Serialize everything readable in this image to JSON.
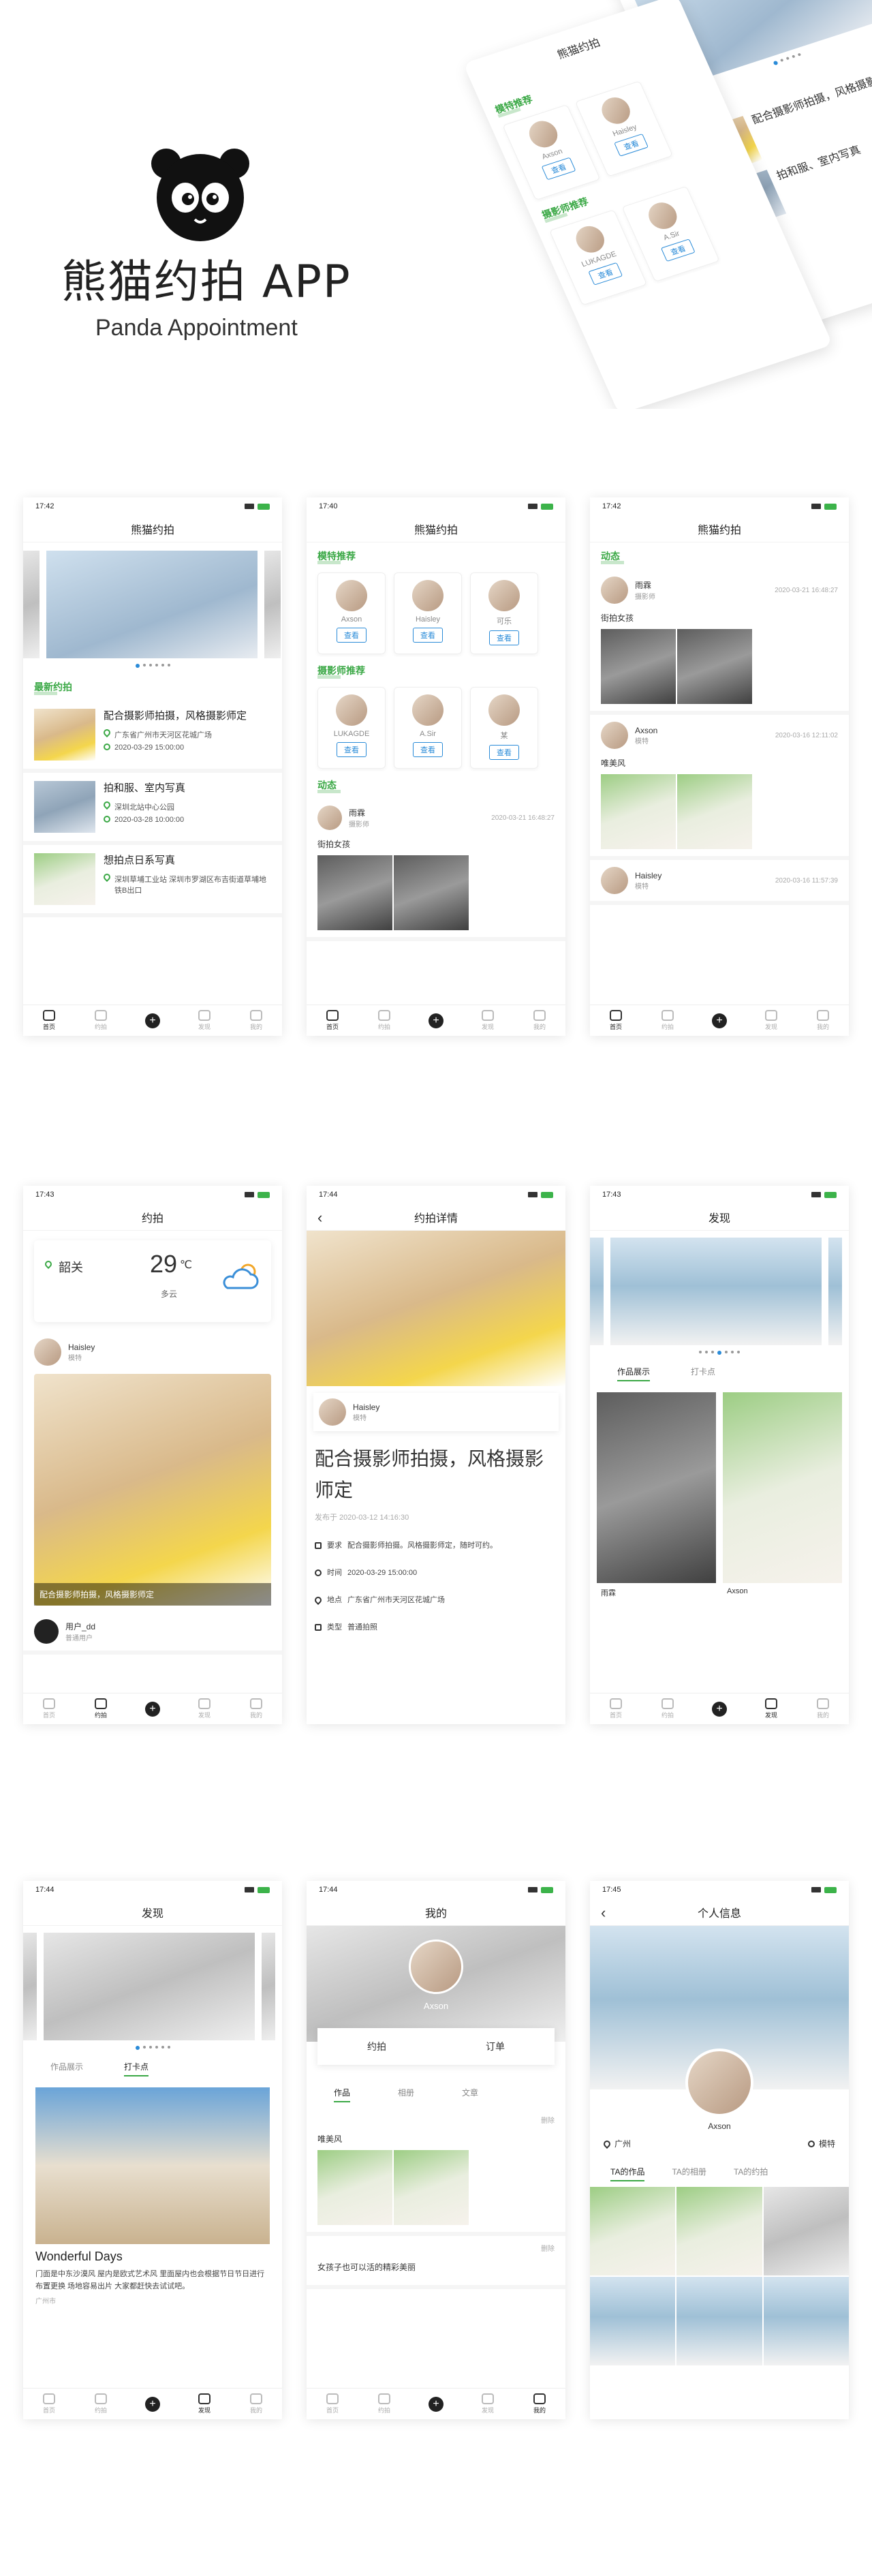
{
  "brand": {
    "title": "熊猫约拍  APP",
    "subtitle": "Panda Appointment"
  },
  "common": {
    "time1": "17:42",
    "time2": "17:40",
    "time3": "17:43",
    "time4": "17:44",
    "time5": "17:45",
    "app_title": "熊猫约拍",
    "view": "查看",
    "plus": "+",
    "tabs": [
      "首页",
      "约拍",
      "",
      "发现",
      "我的"
    ]
  },
  "sections": {
    "latest": "最新约拍",
    "model_rec": "模特推荐",
    "photographer_rec": "摄影师推荐",
    "feed": "动态"
  },
  "home": {
    "items": [
      {
        "title": "配合摄影师拍摄，风格摄影师定",
        "addr": "广东省广州市天河区花城广场",
        "time": "2020-03-29 15:00:00"
      },
      {
        "title": "拍和服、室内写真",
        "addr": "深圳北站中心公园",
        "time": "2020-03-28 10:00:00"
      },
      {
        "title": "想拍点日系写真",
        "addr": "深圳草埔工业站 深圳市罗湖区布吉街道草埔地铁B出口",
        "time": ""
      }
    ]
  },
  "models": [
    "Axson",
    "Haisley",
    "可乐"
  ],
  "photographers": [
    "LUKAGDE",
    "A.Sir",
    "某"
  ],
  "feed": [
    {
      "name": "雨霖",
      "role": "摄影师",
      "time": "2020-03-21 16:48:27",
      "text": "街拍女孩"
    },
    {
      "name": "Axson",
      "role": "模特",
      "time": "2020-03-16 12:11:02",
      "text": "唯美风"
    },
    {
      "name": "Haisley",
      "role": "模特",
      "time": "2020-03-16 11:57:39",
      "text": ""
    }
  ],
  "yuepai": {
    "title": "约拍",
    "city": "韶关",
    "temp": "29",
    "unit": "℃",
    "weather": "多云",
    "user": "Haisley",
    "role": "模特",
    "caption": "配合摄影师拍摄，风格摄影师定",
    "user2": "用户_dd",
    "role2": "普通用户"
  },
  "detail": {
    "title": "约拍详情",
    "user": "Haisley",
    "role": "模特",
    "headline": "配合摄影师拍摄，风格摄影师定",
    "posted": "发布于 2020-03-12 14:16:30",
    "req_label": "要求",
    "req": "配合摄影师拍摄。风格摄影师定，随时可约。",
    "time_label": "时间",
    "time": "2020-03-29 15:00:00",
    "addr_label": "地点",
    "addr": "广东省广州市天河区花城广场",
    "type_label": "类型",
    "type": "普通拍照"
  },
  "discover": {
    "title": "发现",
    "tab1": "作品展示",
    "tab2": "打卡点",
    "names": [
      "雨霖",
      "Axson"
    ],
    "spot_title": "Wonderful Days",
    "spot_desc": "门面是中东沙漠风 屋内是欧式艺术风 里面屋内也会根据节日节日进行布置更换 场地容易出片 大家都赶快去试试吧。",
    "spot_city": "广州市"
  },
  "mine": {
    "title": "我的",
    "name": "Axson",
    "btn1": "约拍",
    "btn2": "订单",
    "tabs": [
      "作品",
      "相册",
      "文章"
    ],
    "del": "删除",
    "post1": "唯美风",
    "post2": "女孩子也可以活的精彩美丽"
  },
  "profile": {
    "title": "个人信息",
    "name": "Axson",
    "city": "广州",
    "role": "模特",
    "tabs": [
      "TA的作品",
      "TA的相册",
      "TA的约拍"
    ]
  }
}
